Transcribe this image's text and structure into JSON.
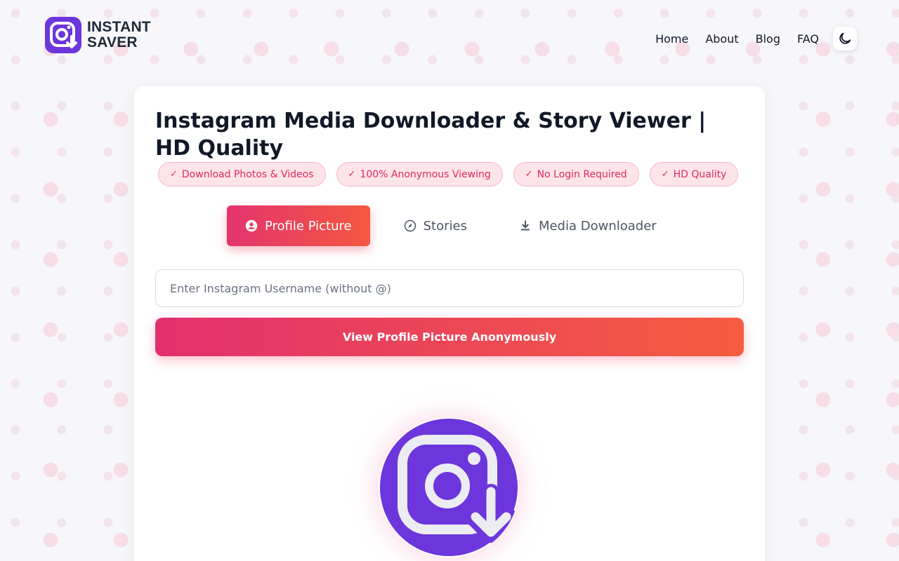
{
  "brand": {
    "line1": "INSTANT",
    "line2": "SAVER",
    "color": "#6d35dc"
  },
  "nav": {
    "items": [
      {
        "label": "Home"
      },
      {
        "label": "About"
      },
      {
        "label": "Blog"
      },
      {
        "label": "FAQ"
      }
    ],
    "theme_icon": "moon-icon"
  },
  "main": {
    "title": "Instagram Media Downloader & Story Viewer | HD Quality",
    "badges": [
      {
        "label": "Download Photos & Videos"
      },
      {
        "label": "100% Anonymous Viewing"
      },
      {
        "label": "No Login Required"
      },
      {
        "label": "HD Quality"
      }
    ],
    "badge_check": "✓",
    "tabs": [
      {
        "label": "Profile Picture",
        "icon": "user-circle-icon",
        "active": true
      },
      {
        "label": "Stories",
        "icon": "compass-icon",
        "active": false
      },
      {
        "label": "Media Downloader",
        "icon": "download-icon",
        "active": false
      }
    ],
    "search": {
      "placeholder": "Enter Instagram Username (without @)",
      "value": ""
    },
    "submit_label": "View Profile Picture Anonymously"
  },
  "colors": {
    "accent_start": "#e2306e",
    "accent_end": "#f55d40",
    "badge_text": "#db2c5d",
    "badge_bg": "#fde4ea",
    "logo_purple": "#6d35dc"
  }
}
